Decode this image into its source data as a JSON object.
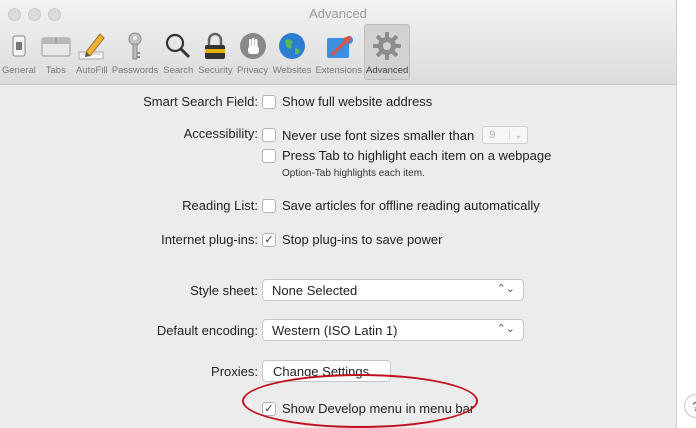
{
  "window": {
    "title": "Advanced"
  },
  "toolbar": [
    {
      "id": "general",
      "label": "General",
      "icon": "general-switch-icon"
    },
    {
      "id": "tabs",
      "label": "Tabs",
      "icon": "tabs-icon"
    },
    {
      "id": "autofill",
      "label": "AutoFill",
      "icon": "pencil-icon"
    },
    {
      "id": "passwords",
      "label": "Passwords",
      "icon": "key-icon"
    },
    {
      "id": "search",
      "label": "Search",
      "icon": "magnifier-icon"
    },
    {
      "id": "security",
      "label": "Security",
      "icon": "padlock-icon"
    },
    {
      "id": "privacy",
      "label": "Privacy",
      "icon": "hand-icon"
    },
    {
      "id": "websites",
      "label": "Websites",
      "icon": "globe-icon"
    },
    {
      "id": "extensions",
      "label": "Extensions",
      "icon": "puzzle-icon"
    },
    {
      "id": "advanced",
      "label": "Advanced",
      "icon": "gear-icon",
      "selected": true
    }
  ],
  "settings": {
    "smart_search": {
      "label": "Smart Search Field:",
      "option": "Show full website address",
      "checked": false
    },
    "accessibility": {
      "label": "Accessibility:",
      "option1": "Never use font sizes smaller than",
      "font_size": "9",
      "option2": "Press Tab to highlight each item on a webpage",
      "note": "Option-Tab highlights each item."
    },
    "reading_list": {
      "label": "Reading List:",
      "option": "Save articles for offline reading automatically",
      "checked": false
    },
    "plugins": {
      "label": "Internet plug-ins:",
      "option": "Stop plug-ins to save power",
      "checked": true
    },
    "style_sheet": {
      "label": "Style sheet:",
      "value": "None Selected"
    },
    "encoding": {
      "label": "Default encoding:",
      "value": "Western (ISO Latin 1)"
    },
    "proxies": {
      "label": "Proxies:",
      "button": "Change Settings..."
    },
    "develop": {
      "option": "Show Develop menu in menu bar",
      "checked": true
    }
  },
  "glyphs": {
    "check": "✓",
    "popup_arrows": "⌃⌄",
    "stepper": "⌄",
    "help": "?"
  },
  "colors": {
    "highlight_ellipse": "#c0121c",
    "selected_tab": "#d2d2d2"
  }
}
